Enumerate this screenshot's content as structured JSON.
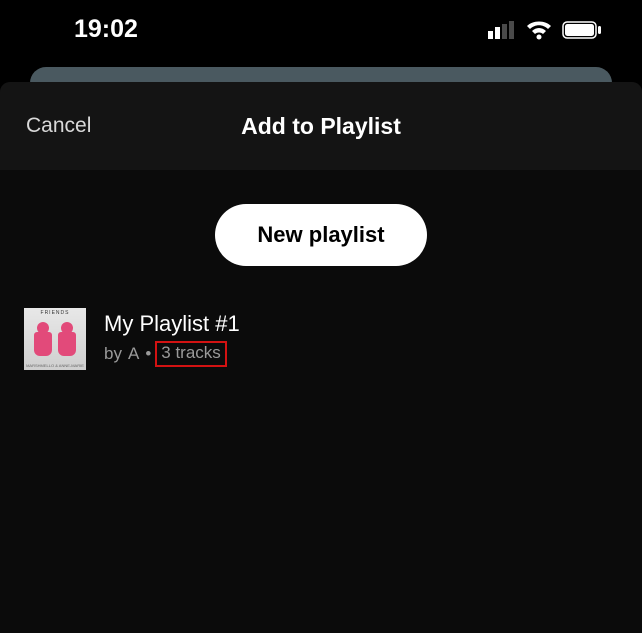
{
  "status": {
    "time": "19:02"
  },
  "sheet": {
    "cancel_label": "Cancel",
    "title": "Add to Playlist",
    "new_playlist_label": "New playlist"
  },
  "playlists": [
    {
      "name": "My Playlist #1",
      "by_prefix": "by",
      "author": "A",
      "tracks_label": "3 tracks",
      "cover_top": "FRIENDS",
      "cover_bottom": "MARSHMELLO & ANNE-MARIE"
    }
  ]
}
